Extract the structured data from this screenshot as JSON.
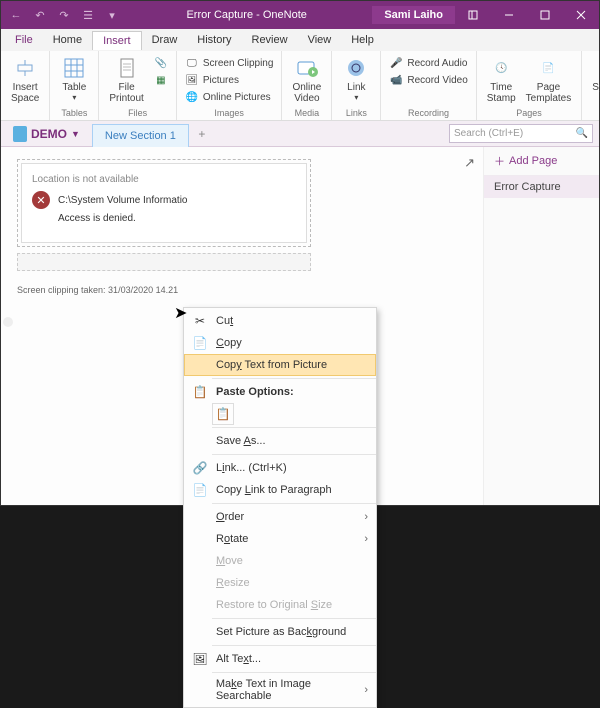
{
  "titlebar": {
    "title": "Error Capture - OneNote",
    "user": "Sami Laiho"
  },
  "menu": {
    "file": "File",
    "home": "Home",
    "insert": "Insert",
    "draw": "Draw",
    "history": "History",
    "review": "Review",
    "view": "View",
    "help": "Help"
  },
  "ribbon": {
    "insert_space": "Insert\nSpace",
    "table": "Table",
    "file_printout": "File\nPrintout",
    "screen_clipping": "Screen Clipping",
    "pictures": "Pictures",
    "online_pictures": "Online Pictures",
    "online_video": "Online\nVideo",
    "link": "Link",
    "record_audio": "Record Audio",
    "record_video": "Record Video",
    "time_stamp": "Time\nStamp",
    "page_templates": "Page\nTemplates",
    "symbols": "Symbols",
    "g_tables": "Tables",
    "g_files": "Files",
    "g_images": "Images",
    "g_media": "Media",
    "g_links": "Links",
    "g_recording": "Recording",
    "g_pages": "Pages"
  },
  "notebook": {
    "name": "DEMO",
    "section": "New Section 1",
    "search_placeholder": "Search (Ctrl+E)"
  },
  "pages": {
    "add": "Add Page",
    "current": "Error Capture"
  },
  "clip": {
    "loc": "Location is not available",
    "path": "C:\\System Volume Informatio",
    "denied": "Access is denied.",
    "meta": "Screen clipping taken: 31/03/2020 14.21"
  },
  "ctx": {
    "cut": "Cut",
    "copy": "Copy",
    "copy_text": "Copy Text from Picture",
    "paste_options": "Paste Options:",
    "save_as": "Save As...",
    "link": "Link...  (Ctrl+K)",
    "copy_link": "Copy Link to Paragraph",
    "order": "Order",
    "rotate": "Rotate",
    "move": "Move",
    "resize": "Resize",
    "restore": "Restore to Original Size",
    "set_bg": "Set Picture as Background",
    "alt_text": "Alt Text...",
    "searchable": "Make Text in Image Searchable"
  }
}
